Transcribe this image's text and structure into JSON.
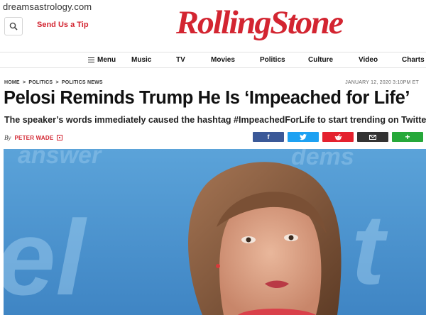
{
  "watermark": "dreamsastrology.com",
  "header": {
    "send_tip": "Send Us a Tip",
    "logo": "RollingStone"
  },
  "nav": {
    "menu": "Menu",
    "items": [
      "Music",
      "TV",
      "Movies",
      "Politics",
      "Culture",
      "Video",
      "Charts"
    ]
  },
  "breadcrumb": [
    "HOME",
    ">",
    "POLITICS",
    ">",
    "POLITICS NEWS"
  ],
  "article": {
    "date": "JANUARY 12, 2020 3:10PM ET",
    "headline": "Pelosi Reminds Trump He Is ‘Impeached for Life’",
    "subheadline": "The speaker’s words immediately caused the hashtag #ImpeachedForLife to start trending on Twitter",
    "by": "By",
    "author": "PETER WADE"
  },
  "share": {
    "facebook": "f",
    "more": "+",
    "colors": {
      "facebook": "#3b5998",
      "twitter": "#1da1f2",
      "reddit": "#e4212e",
      "email": "#333333",
      "more": "#26a83a"
    }
  },
  "colors": {
    "brand": "#d32531"
  }
}
